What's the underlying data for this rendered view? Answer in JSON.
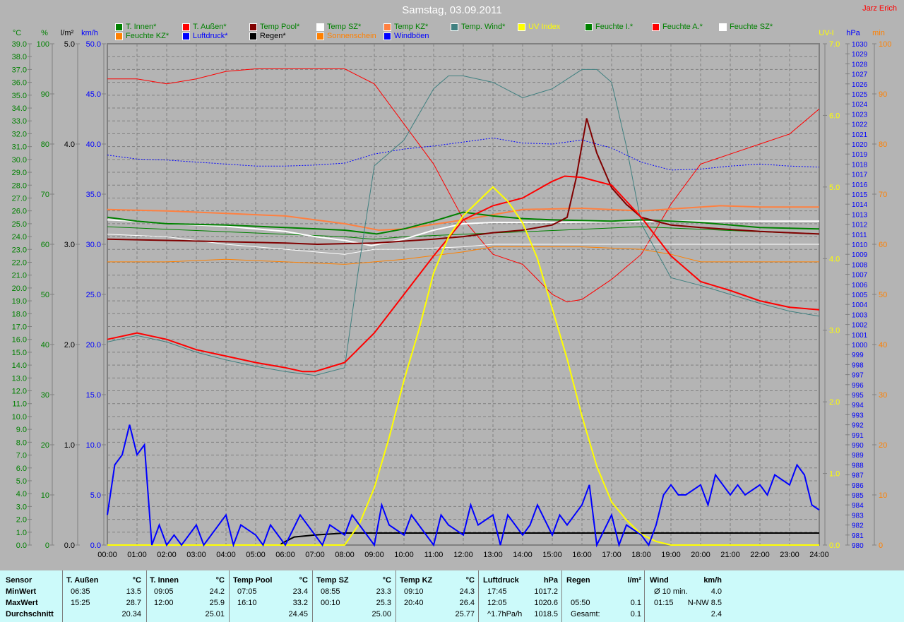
{
  "header": {
    "title": "Samstag, 03.09.2011",
    "author": "Jarz Erich"
  },
  "legend": [
    {
      "label": "T. Innen*",
      "swatch": "#008000",
      "text": "#008000"
    },
    {
      "label": "T. Außen*",
      "swatch": "#ff0000",
      "text": "#008000"
    },
    {
      "label": "Temp Pool*",
      "swatch": "#800000",
      "text": "#008000"
    },
    {
      "label": "Temp SZ*",
      "swatch": "#ffffff",
      "text": "#008000"
    },
    {
      "label": "Temp KZ*",
      "swatch": "#ff8040",
      "text": "#008000"
    },
    {
      "label": "Temp. Wind*",
      "swatch": "#408080",
      "text": "#008000"
    },
    {
      "label": "UV Index",
      "swatch": "#ffff00",
      "text": "#ffff00"
    },
    {
      "label": "Feuchte I.*",
      "swatch": "#008000",
      "text": "#008000"
    },
    {
      "label": "Feuchte A.*",
      "swatch": "#ff0000",
      "text": "#008000"
    },
    {
      "label": "Feuchte SZ*",
      "swatch": "#ffffff",
      "text": "#008000"
    },
    {
      "label": "Feuchte KZ*",
      "swatch": "#ff8000",
      "text": "#008000"
    },
    {
      "label": "Luftdruck*",
      "swatch": "#0000ff",
      "text": "#0000ff"
    },
    {
      "label": "Regen*",
      "swatch": "#000000",
      "text": "#000000"
    },
    {
      "label": "Sonnenschein",
      "swatch": "#ff8000",
      "text": "#ff8000"
    },
    {
      "label": "Windböen",
      "swatch": "#0000ff",
      "text": "#0000ff"
    }
  ],
  "chart_data": {
    "type": "line",
    "title": "Samstag, 03.09.2011",
    "x_unit": "hour",
    "xlim": [
      0,
      24
    ],
    "x_ticks": [
      "00:00",
      "01:00",
      "02:00",
      "03:00",
      "04:00",
      "05:00",
      "06:00",
      "07:00",
      "08:00",
      "09:00",
      "10:00",
      "11:00",
      "12:00",
      "13:00",
      "14:00",
      "15:00",
      "16:00",
      "17:00",
      "18:00",
      "19:00",
      "20:00",
      "21:00",
      "22:00",
      "23:00",
      "24:00"
    ],
    "axes": [
      {
        "id": "c",
        "label": "°C",
        "min": 0,
        "max": 39,
        "step": 1,
        "dec": 1,
        "side": "left",
        "color": "#008000"
      },
      {
        "id": "pct",
        "label": "%",
        "min": 0,
        "max": 100,
        "step": 10,
        "dec": 0,
        "side": "left",
        "color": "#008000"
      },
      {
        "id": "rain",
        "label": "l/m²",
        "min": 0,
        "max": 5,
        "step": 1,
        "dec": 1,
        "side": "left",
        "color": "#000000"
      },
      {
        "id": "kmh",
        "label": "km/h",
        "min": 0,
        "max": 50,
        "step": 5,
        "dec": 1,
        "side": "left",
        "color": "#0000ff"
      },
      {
        "id": "uv",
        "label": "UV-I",
        "min": 0,
        "max": 7,
        "step": 1,
        "dec": 1,
        "side": "right",
        "color": "#ffff00"
      },
      {
        "id": "hpa",
        "label": "hPa",
        "min": 980,
        "max": 1030,
        "step": 1,
        "dec": 0,
        "side": "right",
        "color": "#0000ff"
      },
      {
        "id": "min",
        "label": "min",
        "min": 0,
        "max": 100,
        "step": 10,
        "dec": 0,
        "side": "right",
        "color": "#ff8000"
      }
    ],
    "series": [
      {
        "name": "Feuchte A.",
        "axis": "pct",
        "color": "#ff0000",
        "width": 1,
        "x": [
          0,
          1,
          2,
          3,
          4,
          5,
          6,
          7,
          8,
          9,
          10,
          11,
          12,
          13,
          14,
          15,
          15.5,
          16,
          17,
          18,
          19,
          20,
          21,
          22,
          23,
          24
        ],
        "y": [
          93,
          93,
          92,
          93,
          94.5,
          95,
          95,
          95,
          95,
          92,
          84,
          76,
          65,
          58,
          56,
          50,
          48.5,
          49,
          53,
          58,
          68,
          76,
          78,
          80,
          82,
          87
        ]
      },
      {
        "name": "Feuchte SZ",
        "axis": "pct",
        "color": "#ffffff",
        "width": 1,
        "x": [
          0,
          2,
          4,
          6,
          7,
          8,
          9,
          10,
          12,
          13,
          16,
          20,
          24
        ],
        "y": [
          62,
          61.5,
          60,
          59,
          58.5,
          58,
          59,
          59,
          59.5,
          60,
          60,
          60,
          60
        ]
      },
      {
        "name": "Feuchte I.",
        "axis": "pct",
        "color": "#008000",
        "width": 1,
        "x": [
          0,
          2,
          4,
          6,
          8,
          9,
          10,
          12,
          14,
          16,
          18,
          20,
          22,
          24
        ],
        "y": [
          63.5,
          63,
          62.5,
          62,
          61.5,
          61,
          61.5,
          62,
          62.5,
          63,
          63.5,
          63,
          62.5,
          62
        ]
      },
      {
        "name": "Feuchte KZ",
        "axis": "pct",
        "color": "#ff8000",
        "width": 1,
        "x": [
          0,
          2,
          4,
          6,
          8,
          9,
          10,
          12,
          13,
          14,
          16,
          18,
          19,
          20,
          24
        ],
        "y": [
          56.5,
          56.5,
          57,
          56.5,
          56,
          56.5,
          57,
          58.5,
          59.5,
          59.5,
          59.5,
          59,
          58,
          56.5,
          56.5
        ]
      },
      {
        "name": "Luftdruck",
        "axis": "hpa",
        "color": "#0000ff",
        "width": 1,
        "dash": "2,2",
        "x": [
          0,
          1,
          2,
          3,
          4,
          5,
          6,
          7,
          8,
          9,
          10,
          11,
          12,
          13,
          14,
          15,
          16,
          17,
          18,
          19,
          20,
          21,
          22,
          23,
          24
        ],
        "y": [
          1018.9,
          1018.5,
          1018.4,
          1018.2,
          1018.0,
          1017.8,
          1017.8,
          1017.9,
          1018.1,
          1019.0,
          1019.5,
          1019.8,
          1020.2,
          1020.6,
          1020.1,
          1020.0,
          1020.4,
          1019.6,
          1018.2,
          1017.4,
          1017.5,
          1017.8,
          1018.0,
          1017.8,
          1017.7
        ]
      },
      {
        "name": "Temp KZ",
        "axis": "c",
        "color": "#ff8040",
        "width": 2,
        "x": [
          0,
          2,
          4,
          6,
          8,
          9.15,
          10,
          12,
          13,
          14,
          16,
          18,
          20.66,
          22,
          24
        ],
        "y": [
          26.1,
          26.0,
          25.8,
          25.6,
          25.0,
          24.5,
          24.6,
          25.3,
          25.7,
          26.1,
          26.2,
          26.0,
          26.4,
          26.3,
          26.3
        ]
      },
      {
        "name": "Temp SZ",
        "axis": "c",
        "color": "#ffffff",
        "width": 2,
        "x": [
          0,
          1,
          2,
          4,
          6,
          7,
          8,
          8.9,
          10,
          11,
          12,
          13,
          15,
          18,
          21,
          24
        ],
        "y": [
          25.3,
          25.2,
          25.0,
          24.8,
          24.4,
          24.0,
          23.7,
          23.3,
          23.8,
          24.5,
          25.0,
          25.1,
          25.1,
          25.2,
          25.2,
          25.2
        ]
      },
      {
        "name": "T. Innen",
        "axis": "c",
        "color": "#008000",
        "width": 2,
        "x": [
          0,
          1,
          2,
          4,
          6,
          8,
          9.08,
          10,
          11,
          12,
          13,
          14,
          15,
          17,
          18,
          20,
          22,
          24
        ],
        "y": [
          25.5,
          25.2,
          25.0,
          24.9,
          24.7,
          24.5,
          24.2,
          24.6,
          25.2,
          25.9,
          25.6,
          25.4,
          25.3,
          25.2,
          25.3,
          25.1,
          24.7,
          24.6
        ]
      },
      {
        "name": "Temp Pool",
        "axis": "c",
        "color": "#800000",
        "width": 2,
        "x": [
          0,
          2,
          4,
          6,
          7.08,
          9,
          11,
          12,
          13,
          14,
          15,
          15.5,
          15.8,
          16.16,
          16.5,
          17,
          17.5,
          18,
          19,
          20,
          22,
          24
        ],
        "y": [
          23.8,
          23.7,
          23.6,
          23.5,
          23.4,
          23.5,
          23.8,
          24.0,
          24.3,
          24.5,
          24.9,
          25.5,
          28.5,
          33.2,
          30.5,
          27.8,
          26.5,
          25.5,
          24.9,
          24.7,
          24.4,
          24.2
        ]
      },
      {
        "name": "Temp. Wind",
        "axis": "c",
        "color": "#408080",
        "width": 1,
        "x": [
          0,
          1,
          2,
          3,
          4,
          5,
          6,
          7,
          8,
          8.5,
          9,
          10,
          11,
          11.5,
          12,
          13,
          14,
          15,
          16,
          16.5,
          17,
          17.5,
          18,
          19,
          20,
          21,
          22,
          23,
          24
        ],
        "y": [
          15.8,
          16.3,
          15.8,
          15.0,
          14.4,
          13.9,
          13.5,
          13.2,
          13.8,
          22,
          29.5,
          31.5,
          35.5,
          36.5,
          36.5,
          36,
          34.8,
          35.5,
          37,
          37,
          36,
          31,
          25,
          20.8,
          20.2,
          19.5,
          18.8,
          18.2,
          17.8
        ]
      },
      {
        "name": "T. Außen",
        "axis": "c",
        "color": "#ff0000",
        "width": 2,
        "x": [
          0,
          1,
          2,
          3,
          4,
          5,
          6,
          6.58,
          7,
          8,
          9,
          10,
          11,
          12,
          13,
          14,
          15,
          15.42,
          16,
          17,
          18,
          19,
          20,
          21,
          22,
          23,
          24
        ],
        "y": [
          16.0,
          16.5,
          16.0,
          15.2,
          14.7,
          14.2,
          13.8,
          13.5,
          13.5,
          14.2,
          16.5,
          19.5,
          22.5,
          25.3,
          26.4,
          27.0,
          28.3,
          28.7,
          28.6,
          28.0,
          25.5,
          22.5,
          20.5,
          19.8,
          19.0,
          18.5,
          18.3
        ]
      },
      {
        "name": "Regen",
        "axis": "rain",
        "color": "#000000",
        "width": 2,
        "x": [
          0,
          5.83,
          5.9,
          6.3,
          7,
          8,
          24
        ],
        "y": [
          0,
          0,
          0.02,
          0.08,
          0.1,
          0.12,
          0.12
        ]
      },
      {
        "name": "UV Index",
        "axis": "uv",
        "color": "#ffff00",
        "width": 2,
        "x": [
          0,
          8,
          8.5,
          9,
          9.5,
          10,
          10.5,
          11,
          11.5,
          12,
          12.5,
          13,
          13.5,
          14,
          14.5,
          15,
          15.5,
          16,
          16.5,
          17,
          17.5,
          18,
          18.5,
          19,
          24
        ],
        "y": [
          0,
          0,
          0.3,
          0.8,
          1.5,
          2.3,
          3.0,
          3.8,
          4.3,
          4.6,
          4.8,
          5.0,
          4.8,
          4.5,
          4.0,
          3.3,
          2.6,
          1.8,
          1.1,
          0.6,
          0.35,
          0.15,
          0.05,
          0,
          0
        ]
      },
      {
        "name": "Windböen",
        "axis": "kmh",
        "color": "#0000ff",
        "width": 2,
        "x": [
          0,
          0.25,
          0.5,
          0.75,
          1,
          1.25,
          1.5,
          1.75,
          2,
          2.25,
          2.5,
          3,
          3.25,
          3.5,
          4,
          4.25,
          4.5,
          5,
          5.25,
          5.5,
          6,
          6.5,
          7,
          7.25,
          7.5,
          8,
          8.25,
          8.5,
          9,
          9.25,
          9.5,
          10,
          10.25,
          10.5,
          11,
          11.25,
          11.5,
          12,
          12.25,
          12.5,
          13,
          13.25,
          13.5,
          14,
          14.25,
          14.5,
          15,
          15.25,
          15.5,
          16,
          16.25,
          16.5,
          17,
          17.25,
          17.5,
          18,
          18.25,
          18.5,
          18.75,
          19,
          19.25,
          19.5,
          20,
          20.25,
          20.5,
          21,
          21.25,
          21.5,
          22,
          22.25,
          22.5,
          23,
          23.25,
          23.5,
          23.75,
          24
        ],
        "y": [
          3,
          8,
          9,
          12,
          9,
          10,
          0,
          2,
          0,
          1,
          0,
          2,
          0,
          1,
          3,
          0,
          2,
          1,
          0,
          2,
          0,
          3,
          1,
          0,
          2,
          1,
          3,
          2,
          0,
          4,
          2,
          1,
          3,
          2,
          0,
          3,
          2,
          1,
          4,
          2,
          3,
          0,
          3,
          1,
          2,
          4,
          1,
          3,
          2,
          4,
          6,
          0,
          3,
          0,
          2,
          1,
          0,
          2,
          5,
          6,
          5,
          5,
          6,
          4,
          7,
          5,
          6,
          5,
          6,
          5,
          7,
          6,
          8,
          7,
          4,
          3.5
        ]
      }
    ]
  },
  "table": {
    "columns": [
      {
        "header": "Sensor",
        "unit": "",
        "rows": [
          [
            "MinWert",
            ""
          ],
          [
            "MaxWert",
            ""
          ],
          [
            "Durchschnitt",
            ""
          ]
        ]
      },
      {
        "header": "T. Außen",
        "unit": "°C",
        "rows": [
          [
            "06:35",
            "13.5"
          ],
          [
            "15:25",
            "28.7"
          ],
          [
            "",
            "20.34"
          ]
        ]
      },
      {
        "header": "T. Innen",
        "unit": "°C",
        "rows": [
          [
            "09:05",
            "24.2"
          ],
          [
            "12:00",
            "25.9"
          ],
          [
            "",
            "25.01"
          ]
        ]
      },
      {
        "header": "Temp Pool",
        "unit": "°C",
        "rows": [
          [
            "07:05",
            "23.4"
          ],
          [
            "16:10",
            "33.2"
          ],
          [
            "",
            "24.45"
          ]
        ]
      },
      {
        "header": "Temp SZ",
        "unit": "°C",
        "rows": [
          [
            "08:55",
            "23.3"
          ],
          [
            "00:10",
            "25.3"
          ],
          [
            "",
            "25.00"
          ]
        ]
      },
      {
        "header": "Temp KZ",
        "unit": "°C",
        "rows": [
          [
            "09:10",
            "24.3"
          ],
          [
            "20:40",
            "26.4"
          ],
          [
            "",
            "25.77"
          ]
        ]
      },
      {
        "header": "Luftdruck",
        "unit": "hPa",
        "rows": [
          [
            "17:45",
            "1017.2"
          ],
          [
            "12:05",
            "1020.6"
          ],
          [
            "^1.7hPa/h",
            "1018.5"
          ]
        ]
      },
      {
        "header": "Regen",
        "unit": "l/m²",
        "rows": [
          [
            "",
            ""
          ],
          [
            "05:50",
            "0.1"
          ],
          [
            "Gesamt:",
            "0.1"
          ]
        ]
      },
      {
        "header": "Wind",
        "unit": "km/h",
        "rows": [
          [
            "Ø 10 min.",
            "4.0"
          ],
          [
            "01:15",
            "N-NW 8.5"
          ],
          [
            "",
            "2.4"
          ]
        ]
      }
    ]
  }
}
